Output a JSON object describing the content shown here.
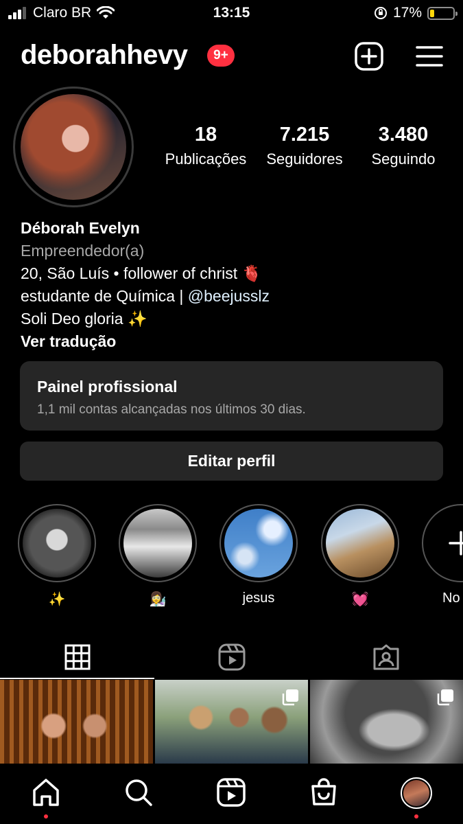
{
  "status_bar": {
    "carrier": "Claro BR",
    "time": "13:15",
    "battery_percent": "17%",
    "battery_level": 0.17
  },
  "header": {
    "username": "deborahhevy",
    "notification_badge": "9+"
  },
  "profile": {
    "stats": [
      {
        "value": "18",
        "label": "Publicações"
      },
      {
        "value": "7.215",
        "label": "Seguidores"
      },
      {
        "value": "3.480",
        "label": "Seguindo"
      }
    ],
    "name": "Déborah Evelyn",
    "category": "Empreendedor(a)",
    "bio_line1": "20, São Luís • follower of christ 🫀",
    "bio_line2_prefix": "estudante de Química | ",
    "bio_mention": "@beejusslz",
    "bio_line3": "Soli Deo gloria ✨",
    "see_translation": "Ver tradução"
  },
  "professional_panel": {
    "title": "Painel profissional",
    "subtitle": "1,1 mil contas alcançadas nos últimos 30 dias."
  },
  "edit_profile_label": "Editar perfil",
  "highlights": [
    {
      "label": "✨"
    },
    {
      "label": "👩‍🔬"
    },
    {
      "label": "jesus"
    },
    {
      "label": "💓"
    },
    {
      "label": "No"
    }
  ],
  "tabs": [
    {
      "icon": "grid-icon"
    },
    {
      "icon": "reels-icon"
    },
    {
      "icon": "tagged-icon"
    }
  ],
  "bottom_nav": [
    {
      "icon": "home-icon"
    },
    {
      "icon": "search-icon"
    },
    {
      "icon": "reels-icon"
    },
    {
      "icon": "shop-icon"
    },
    {
      "icon": "profile-avatar"
    }
  ],
  "colors": {
    "badge": "#ff3040",
    "card": "#262626",
    "muted_text": "#a8a8a8",
    "battery_fill": "#ffd60a"
  }
}
